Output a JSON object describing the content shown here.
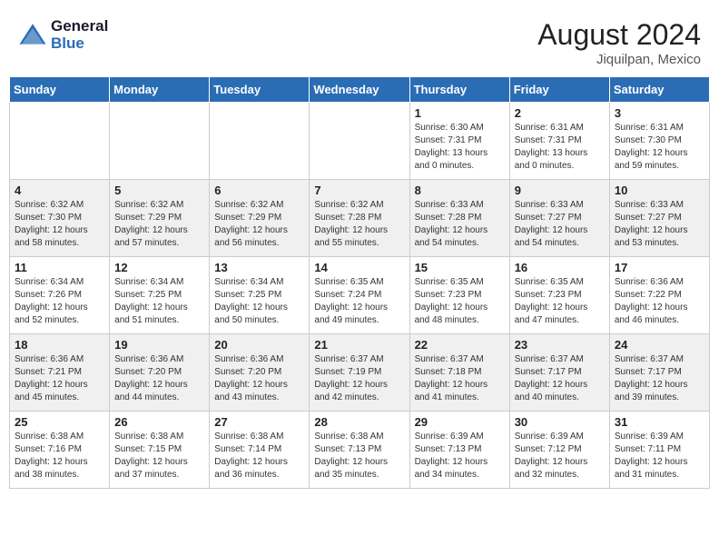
{
  "header": {
    "logo_line1": "General",
    "logo_line2": "Blue",
    "month_year": "August 2024",
    "location": "Jiquilpan, Mexico"
  },
  "weekdays": [
    "Sunday",
    "Monday",
    "Tuesday",
    "Wednesday",
    "Thursday",
    "Friday",
    "Saturday"
  ],
  "weeks": [
    [
      {
        "day": "",
        "info": ""
      },
      {
        "day": "",
        "info": ""
      },
      {
        "day": "",
        "info": ""
      },
      {
        "day": "",
        "info": ""
      },
      {
        "day": "1",
        "info": "Sunrise: 6:30 AM\nSunset: 7:31 PM\nDaylight: 13 hours\nand 0 minutes."
      },
      {
        "day": "2",
        "info": "Sunrise: 6:31 AM\nSunset: 7:31 PM\nDaylight: 13 hours\nand 0 minutes."
      },
      {
        "day": "3",
        "info": "Sunrise: 6:31 AM\nSunset: 7:30 PM\nDaylight: 12 hours\nand 59 minutes."
      }
    ],
    [
      {
        "day": "4",
        "info": "Sunrise: 6:32 AM\nSunset: 7:30 PM\nDaylight: 12 hours\nand 58 minutes."
      },
      {
        "day": "5",
        "info": "Sunrise: 6:32 AM\nSunset: 7:29 PM\nDaylight: 12 hours\nand 57 minutes."
      },
      {
        "day": "6",
        "info": "Sunrise: 6:32 AM\nSunset: 7:29 PM\nDaylight: 12 hours\nand 56 minutes."
      },
      {
        "day": "7",
        "info": "Sunrise: 6:32 AM\nSunset: 7:28 PM\nDaylight: 12 hours\nand 55 minutes."
      },
      {
        "day": "8",
        "info": "Sunrise: 6:33 AM\nSunset: 7:28 PM\nDaylight: 12 hours\nand 54 minutes."
      },
      {
        "day": "9",
        "info": "Sunrise: 6:33 AM\nSunset: 7:27 PM\nDaylight: 12 hours\nand 54 minutes."
      },
      {
        "day": "10",
        "info": "Sunrise: 6:33 AM\nSunset: 7:27 PM\nDaylight: 12 hours\nand 53 minutes."
      }
    ],
    [
      {
        "day": "11",
        "info": "Sunrise: 6:34 AM\nSunset: 7:26 PM\nDaylight: 12 hours\nand 52 minutes."
      },
      {
        "day": "12",
        "info": "Sunrise: 6:34 AM\nSunset: 7:25 PM\nDaylight: 12 hours\nand 51 minutes."
      },
      {
        "day": "13",
        "info": "Sunrise: 6:34 AM\nSunset: 7:25 PM\nDaylight: 12 hours\nand 50 minutes."
      },
      {
        "day": "14",
        "info": "Sunrise: 6:35 AM\nSunset: 7:24 PM\nDaylight: 12 hours\nand 49 minutes."
      },
      {
        "day": "15",
        "info": "Sunrise: 6:35 AM\nSunset: 7:23 PM\nDaylight: 12 hours\nand 48 minutes."
      },
      {
        "day": "16",
        "info": "Sunrise: 6:35 AM\nSunset: 7:23 PM\nDaylight: 12 hours\nand 47 minutes."
      },
      {
        "day": "17",
        "info": "Sunrise: 6:36 AM\nSunset: 7:22 PM\nDaylight: 12 hours\nand 46 minutes."
      }
    ],
    [
      {
        "day": "18",
        "info": "Sunrise: 6:36 AM\nSunset: 7:21 PM\nDaylight: 12 hours\nand 45 minutes."
      },
      {
        "day": "19",
        "info": "Sunrise: 6:36 AM\nSunset: 7:20 PM\nDaylight: 12 hours\nand 44 minutes."
      },
      {
        "day": "20",
        "info": "Sunrise: 6:36 AM\nSunset: 7:20 PM\nDaylight: 12 hours\nand 43 minutes."
      },
      {
        "day": "21",
        "info": "Sunrise: 6:37 AM\nSunset: 7:19 PM\nDaylight: 12 hours\nand 42 minutes."
      },
      {
        "day": "22",
        "info": "Sunrise: 6:37 AM\nSunset: 7:18 PM\nDaylight: 12 hours\nand 41 minutes."
      },
      {
        "day": "23",
        "info": "Sunrise: 6:37 AM\nSunset: 7:17 PM\nDaylight: 12 hours\nand 40 minutes."
      },
      {
        "day": "24",
        "info": "Sunrise: 6:37 AM\nSunset: 7:17 PM\nDaylight: 12 hours\nand 39 minutes."
      }
    ],
    [
      {
        "day": "25",
        "info": "Sunrise: 6:38 AM\nSunset: 7:16 PM\nDaylight: 12 hours\nand 38 minutes."
      },
      {
        "day": "26",
        "info": "Sunrise: 6:38 AM\nSunset: 7:15 PM\nDaylight: 12 hours\nand 37 minutes."
      },
      {
        "day": "27",
        "info": "Sunrise: 6:38 AM\nSunset: 7:14 PM\nDaylight: 12 hours\nand 36 minutes."
      },
      {
        "day": "28",
        "info": "Sunrise: 6:38 AM\nSunset: 7:13 PM\nDaylight: 12 hours\nand 35 minutes."
      },
      {
        "day": "29",
        "info": "Sunrise: 6:39 AM\nSunset: 7:13 PM\nDaylight: 12 hours\nand 34 minutes."
      },
      {
        "day": "30",
        "info": "Sunrise: 6:39 AM\nSunset: 7:12 PM\nDaylight: 12 hours\nand 32 minutes."
      },
      {
        "day": "31",
        "info": "Sunrise: 6:39 AM\nSunset: 7:11 PM\nDaylight: 12 hours\nand 31 minutes."
      }
    ]
  ]
}
